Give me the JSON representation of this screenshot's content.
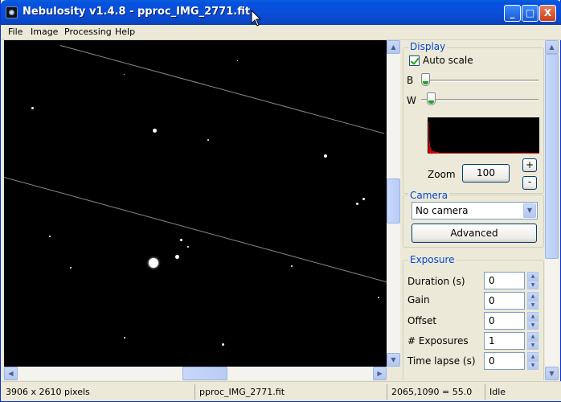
{
  "window": {
    "title": "Nebulosity v1.4.8 - pproc_IMG_2771.fit",
    "controls": [
      "_",
      "□",
      "X"
    ]
  },
  "menu": [
    "File",
    "Image",
    "Processing",
    "Help"
  ],
  "display": {
    "title": "Display",
    "auto_scale": "Auto scale",
    "b_label": "B",
    "w_label": "W",
    "b_level": 0.0,
    "w_level": 0.05,
    "zoom_label": "Zoom",
    "zoom_value": "100",
    "zoom_in": "+",
    "zoom_out": "-"
  },
  "camera": {
    "title": "Camera",
    "selected": "No camera",
    "advanced": "Advanced"
  },
  "exposure": {
    "title": "Exposure",
    "fields": [
      {
        "label": "Duration (s)",
        "value": "0"
      },
      {
        "label": "Gain",
        "value": "0"
      },
      {
        "label": "Offset",
        "value": "0"
      },
      {
        "label": "# Exposures",
        "value": "1"
      },
      {
        "label": "Time lapse (s)",
        "value": "0"
      }
    ]
  },
  "status": {
    "dims": "3906 x 2610 pixels",
    "file": "pproc_IMG_2771.fit",
    "coords": "2065,1090 = 55.0",
    "state": "Idle"
  },
  "colors": {
    "title_bar": "#0a4fd8",
    "group_title": "#0046d5",
    "histogram": "#cc0000"
  }
}
